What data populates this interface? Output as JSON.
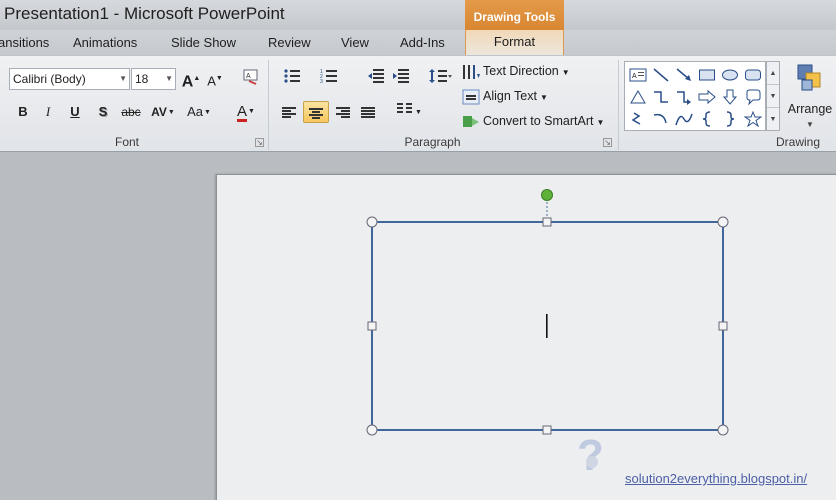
{
  "window": {
    "title": "Presentation1  -  Microsoft PowerPoint",
    "context_tab_group": "Drawing Tools"
  },
  "tabs": [
    {
      "label": "ansitions"
    },
    {
      "label": "Animations"
    },
    {
      "label": "Slide Show"
    },
    {
      "label": "Review"
    },
    {
      "label": "View"
    },
    {
      "label": "Add-Ins"
    },
    {
      "label": "Format"
    }
  ],
  "font_group": {
    "label": "Font",
    "font_name": "Calibri (Body)",
    "font_size": "18",
    "grow_label": "A",
    "shrink_label": "A",
    "bold": "B",
    "italic": "I",
    "underline": "U",
    "shadow": "S",
    "strikethrough": "abc",
    "spacing": "AV",
    "change_case": "Aa",
    "font_color_letter": "A",
    "font_color": "#cc2222"
  },
  "paragraph_group": {
    "label": "Paragraph",
    "text_direction": "Text Direction",
    "align_text": "Align Text",
    "convert_smartart": "Convert to SmartArt"
  },
  "drawing_group": {
    "label": "Drawing",
    "arrange": "Arrange",
    "shapes": [
      "text-box",
      "line",
      "arrow-line",
      "rectangle",
      "oval",
      "rounded-rectangle",
      "triangle",
      "elbow-connector",
      "elbow-arrow-connector",
      "right-arrow",
      "down-arrow",
      "callout",
      "freeform",
      "curve-arrow",
      "curve",
      "left-brace",
      "right-brace",
      "star"
    ]
  },
  "slide": {
    "text_cursor": "|"
  },
  "watermark": "solution2everything.blogspot.in/",
  "colors": {
    "context_tab": "#e0923e",
    "selection_border": "#41669a",
    "rotation_handle": "#5fb13a"
  }
}
